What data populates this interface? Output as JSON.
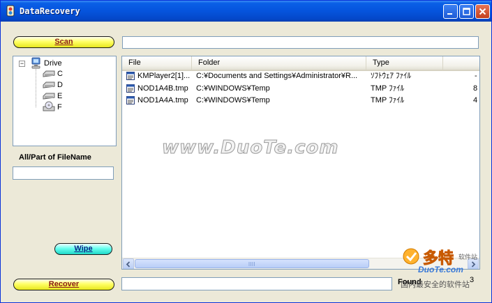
{
  "window": {
    "title": "DataRecovery"
  },
  "buttons": {
    "scan": "Scan",
    "wipe": "Wipe",
    "recover": "Recover"
  },
  "tree": {
    "root": "Drive",
    "expander": "−",
    "drives": [
      "C",
      "D",
      "E",
      "F"
    ]
  },
  "filename_filter": {
    "label": "All/Part of FileName",
    "value": ""
  },
  "list": {
    "columns": [
      "File",
      "Folder",
      "Type"
    ],
    "rows": [
      {
        "file": "KMPlayer2[1]...",
        "folder": "C:¥Documents and Settings¥Administrator¥R...",
        "type": "ｿﾌﾄｳｪｱ ﾌｧｲﾙ",
        "extra": "-"
      },
      {
        "file": "NOD1A4B.tmp",
        "folder": "C:¥WINDOWS¥Temp",
        "type": "TMP ﾌｧｲﾙ",
        "extra": "8"
      },
      {
        "file": "NOD1A4A.tmp",
        "folder": "C:¥WINDOWS¥Temp",
        "type": "TMP ﾌｧｲﾙ",
        "extra": "4"
      }
    ]
  },
  "status": {
    "found_label": "Found",
    "count": "3"
  },
  "watermark": "www.DuoTe.com",
  "logo": {
    "big": "多特",
    "small": "软件站",
    "domain": "DuoTe.com",
    "slogan": "国内最安全的软件站"
  },
  "colors": {
    "titlebar": "#0554dd",
    "scan_button": "#ffff66",
    "wipe_button": "#66ffee",
    "field_border": "#7f9db9"
  }
}
